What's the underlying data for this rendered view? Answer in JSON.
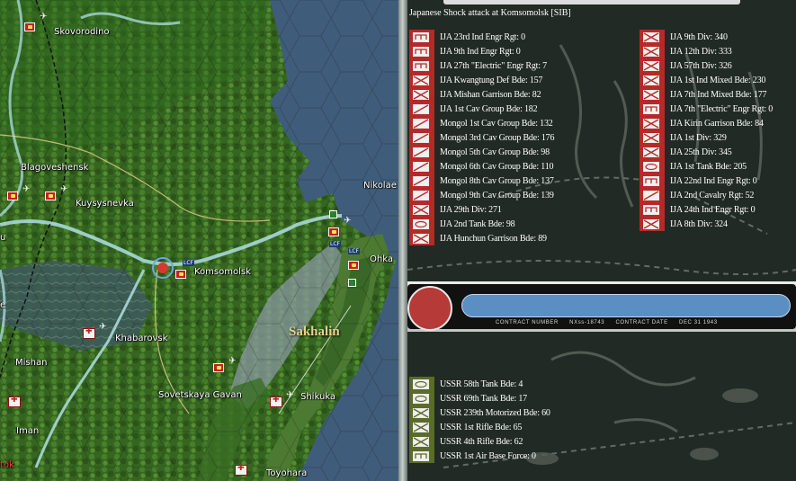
{
  "map": {
    "labels": [
      {
        "id": "skovorodino",
        "text": "Skovorodino"
      },
      {
        "id": "blagoveshensk",
        "text": "Blagoveshensk"
      },
      {
        "id": "kuysysnevka",
        "text": "Kuysysnevka"
      },
      {
        "id": "nikolae",
        "text": "Nikolae"
      },
      {
        "id": "komsomolsk",
        "text": "Komsomolsk"
      },
      {
        "id": "ohka",
        "text": "Ohka"
      },
      {
        "id": "sakhalin",
        "text": "Sakhalin"
      },
      {
        "id": "khabarovsk",
        "text": "Khabarovsk"
      },
      {
        "id": "mishan",
        "text": "Mishan"
      },
      {
        "id": "sovetskaya",
        "text": "Sovetskaya Gavan"
      },
      {
        "id": "shikuka",
        "text": "Shikuka"
      },
      {
        "id": "iman",
        "text": "Iman"
      },
      {
        "id": "toyohara",
        "text": "Toyohara"
      },
      {
        "id": "edge_u",
        "text": "u"
      },
      {
        "id": "edge_e",
        "text": "e"
      },
      {
        "id": "edge_tok",
        "text": "tok"
      }
    ],
    "tags": [
      "LCF",
      "LCF",
      "LCF"
    ],
    "colors": {
      "japan": "#c81e1e",
      "ussr_city": "#f2f2f2",
      "river": "#a8d8d8",
      "sea": "#3f5d7a",
      "land": "#3d6b2a"
    }
  },
  "report": {
    "title": "Japanese Shock attack at Komsomolsk [SIB]",
    "attackers_left": [
      {
        "label": "IJA 23rd Ind Engr Rgt: 0",
        "icon": "engineer-icon"
      },
      {
        "label": "IJA 9th Ind Engr Rgt: 0",
        "icon": "engineer-icon"
      },
      {
        "label": "IJA 27th \"Electric\" Engr Rgt: 7",
        "icon": "engineer-icon"
      },
      {
        "label": "IJA Kwangtung Def Bde: 157",
        "icon": "infantry-icon"
      },
      {
        "label": "IJA Mishan Garrison Bde: 82",
        "icon": "infantry-icon"
      },
      {
        "label": "IJA 1st Cav Group Bde: 182",
        "icon": "cavalry-icon"
      },
      {
        "label": "Mongol 1st Cav Group Bde: 132",
        "icon": "cavalry-icon"
      },
      {
        "label": "Mongol 3rd Cav Group Bde: 176",
        "icon": "cavalry-icon"
      },
      {
        "label": "Mongol 5th Cav Group Bde: 98",
        "icon": "cavalry-icon"
      },
      {
        "label": "Mongol 6th Cav Group Bde: 110",
        "icon": "cavalry-icon"
      },
      {
        "label": "Mongol 8th Cav Group Bde: 137",
        "icon": "cavalry-icon"
      },
      {
        "label": "Mongol 9th Cav Group Bde: 139",
        "icon": "cavalry-icon"
      },
      {
        "label": "IJA 29th Div: 271",
        "icon": "infantry-icon"
      },
      {
        "label": "IJA 2nd Tank Bde: 98",
        "icon": "armor-icon"
      },
      {
        "label": "IJA Hunchun Garrison Bde: 89",
        "icon": "infantry-icon"
      }
    ],
    "attackers_right": [
      {
        "label": "IJA 9th Div: 340",
        "icon": "infantry-icon"
      },
      {
        "label": "IJA 12th Div: 333",
        "icon": "infantry-icon"
      },
      {
        "label": "IJA 57th Div: 326",
        "icon": "infantry-icon"
      },
      {
        "label": "IJA 1st Ind Mixed Bde: 230",
        "icon": "infantry-icon"
      },
      {
        "label": "IJA 7th Ind Mixed Bde: 177",
        "icon": "infantry-icon"
      },
      {
        "label": "IJA 7th \"Electric\" Engr Rgt: 0",
        "icon": "engineer-icon"
      },
      {
        "label": "IJA Kirin Garrison Bde: 84",
        "icon": "infantry-icon"
      },
      {
        "label": "IJA 1st Div: 329",
        "icon": "infantry-icon"
      },
      {
        "label": "IJA 25th Div: 345",
        "icon": "infantry-icon"
      },
      {
        "label": "IJA 1st Tank Bde: 205",
        "icon": "armor-icon"
      },
      {
        "label": "IJA 22nd Ind Engr Rgt: 0",
        "icon": "engineer-icon"
      },
      {
        "label": "IJA 2nd Cavalry Rgt: 52",
        "icon": "cavalry-icon"
      },
      {
        "label": "IJA 24th Ind Engr Rgt: 0",
        "icon": "engineer-icon"
      },
      {
        "label": "IJA 8th Div: 324",
        "icon": "infantry-icon"
      }
    ],
    "banner": {
      "contract_number_label": "CONTRACT NUMBER",
      "contract_number": "NXss-18743",
      "contract_date_label": "CONTRACT DATE",
      "contract_date": "DEC 31 1943"
    },
    "defenders": [
      {
        "label": "USSR 58th Tank Bde: 4",
        "icon": "armor-icon"
      },
      {
        "label": "USSR 69th Tank Bde: 17",
        "icon": "armor-icon"
      },
      {
        "label": "USSR 239th Motorized Bde: 60",
        "icon": "infantry-icon"
      },
      {
        "label": "USSR 1st Rifle Bde: 65",
        "icon": "infantry-icon"
      },
      {
        "label": "USSR 4th Rifle Bde: 62",
        "icon": "infantry-icon"
      },
      {
        "label": "USSR 1st Air Base Force: 0",
        "icon": "engineer-icon"
      }
    ],
    "colors": {
      "japan_bar": "#b52a28",
      "ussr_bar": "#5a6b2a",
      "japan_flag": "#b63a38",
      "ussr_bar_blue": "#5b8fc4"
    }
  }
}
